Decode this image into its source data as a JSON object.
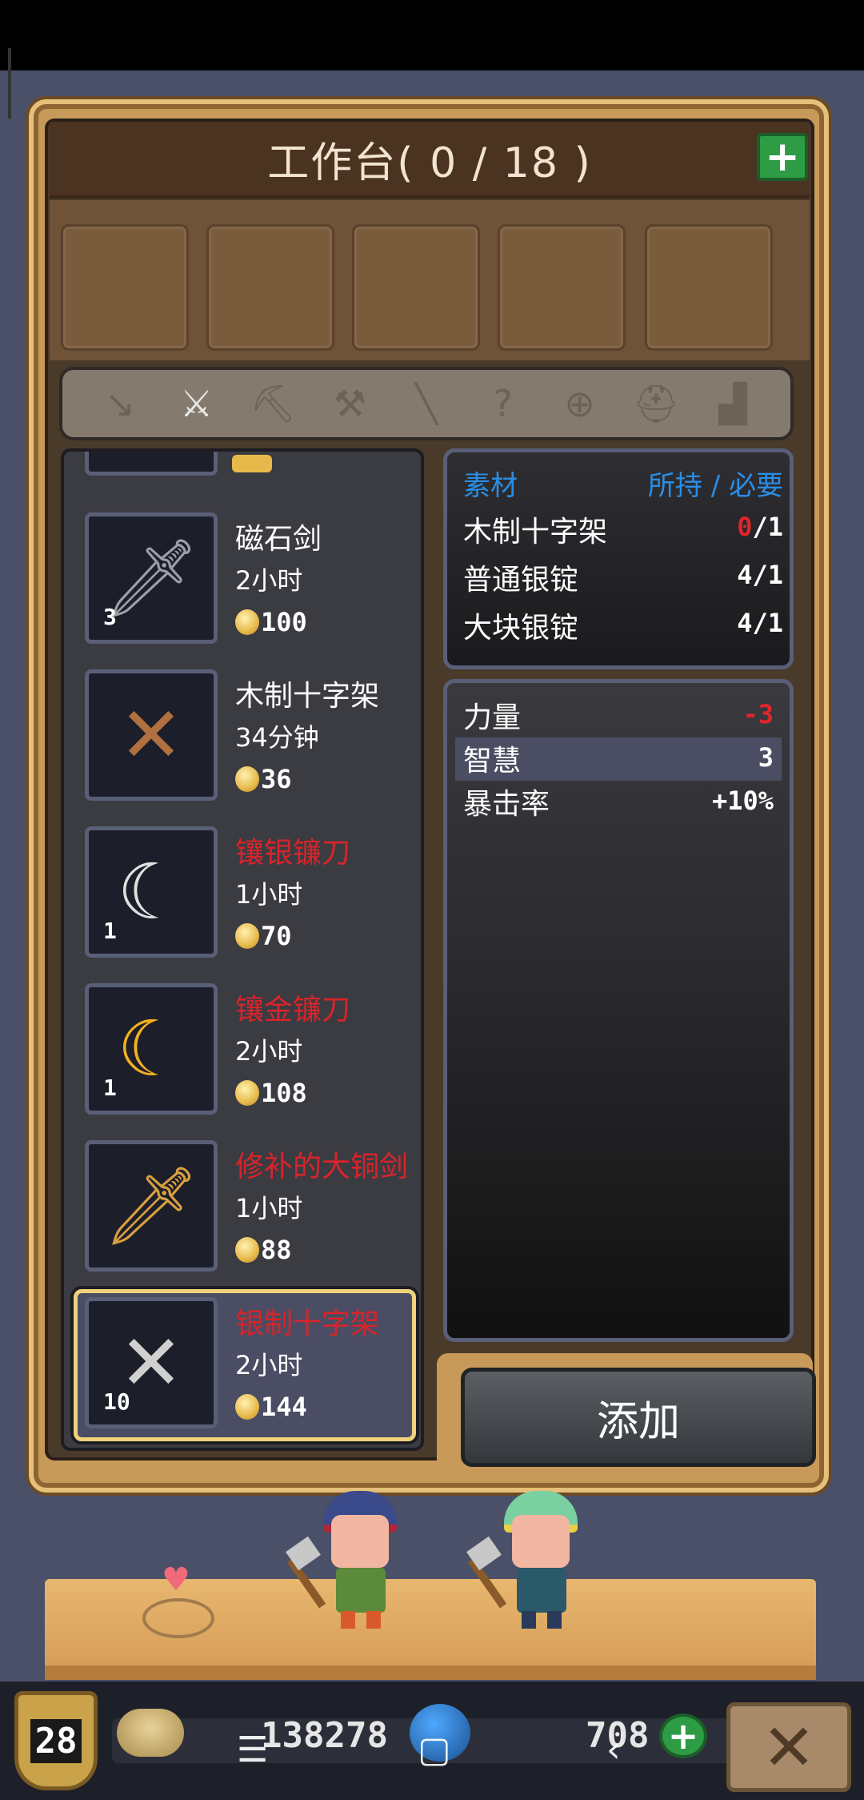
{
  "header": {
    "title": "工作台( 0 / 18 )",
    "add_icon": "+"
  },
  "tabs": [
    {
      "icon": "spear-icon",
      "glyph": "↘",
      "active": false
    },
    {
      "icon": "sword-icon",
      "glyph": "⚔",
      "active": true
    },
    {
      "icon": "axe-icon",
      "glyph": "⛏",
      "active": false
    },
    {
      "icon": "hammer-icon",
      "glyph": "⚒",
      "active": false
    },
    {
      "icon": "staff-icon",
      "glyph": "╲",
      "active": false
    },
    {
      "icon": "unknown-icon",
      "glyph": "?",
      "active": false
    },
    {
      "icon": "bow-icon",
      "glyph": "⊕",
      "active": false
    },
    {
      "icon": "pot-icon",
      "glyph": "⛑",
      "active": false
    },
    {
      "icon": "misc-icon",
      "glyph": "▟",
      "active": false
    }
  ],
  "recipes": [
    {
      "name": "磁石剑",
      "time": "2小时",
      "price": "100",
      "count": "3",
      "red": false,
      "icon": "dark-sword-icon",
      "glyph": "🗡",
      "color": "#9aa0a8"
    },
    {
      "name": "木制十字架",
      "time": "34分钟",
      "price": "36",
      "count": "",
      "red": false,
      "icon": "wooden-cross-icon",
      "glyph": "✕",
      "color": "#b07040"
    },
    {
      "name": "镶银镰刀",
      "time": "1小时",
      "price": "70",
      "count": "1",
      "red": true,
      "icon": "silver-sickle-icon",
      "glyph": "☾",
      "color": "#e0e0e0"
    },
    {
      "name": "镶金镰刀",
      "time": "2小时",
      "price": "108",
      "count": "1",
      "red": true,
      "icon": "gold-sickle-icon",
      "glyph": "☾",
      "color": "#f0b020"
    },
    {
      "name": "修补的大铜剑",
      "time": "1小时",
      "price": "88",
      "count": "",
      "red": true,
      "icon": "bronze-sword-icon",
      "glyph": "🗡",
      "color": "#d8a040"
    },
    {
      "name": "银制十字架",
      "time": "2小时",
      "price": "144",
      "count": "10",
      "red": true,
      "icon": "silver-cross-icon",
      "glyph": "✕",
      "color": "#d0d0d0",
      "selected": true
    }
  ],
  "materials": {
    "header_left": "素材",
    "header_right": "所持 / 必要",
    "rows": [
      {
        "name": "木制十字架",
        "have": "0",
        "need": "/1",
        "insufficient": true
      },
      {
        "name": "普通银锭",
        "have": "4",
        "need": "/1",
        "insufficient": false
      },
      {
        "name": "大块银锭",
        "have": "4",
        "need": "/1",
        "insufficient": false
      }
    ]
  },
  "stats": [
    {
      "name": "力量",
      "value": "-3",
      "negative": true,
      "highlight": false
    },
    {
      "name": "智慧",
      "value": "3",
      "negative": false,
      "highlight": true
    },
    {
      "name": "暴击率",
      "value": "+10%",
      "negative": false,
      "highlight": false
    }
  ],
  "add_button": "添加",
  "hud": {
    "level": "28",
    "gold": "138278",
    "gems": "708",
    "gem_plus": "+",
    "close_glyph": "✕"
  },
  "nav": {
    "menu": "☰",
    "home": "▢",
    "back": "‹"
  },
  "colors": {
    "accent_green": "#2e9b45",
    "warning_red": "#e3242b",
    "material_blue": "#2a8ee6"
  }
}
